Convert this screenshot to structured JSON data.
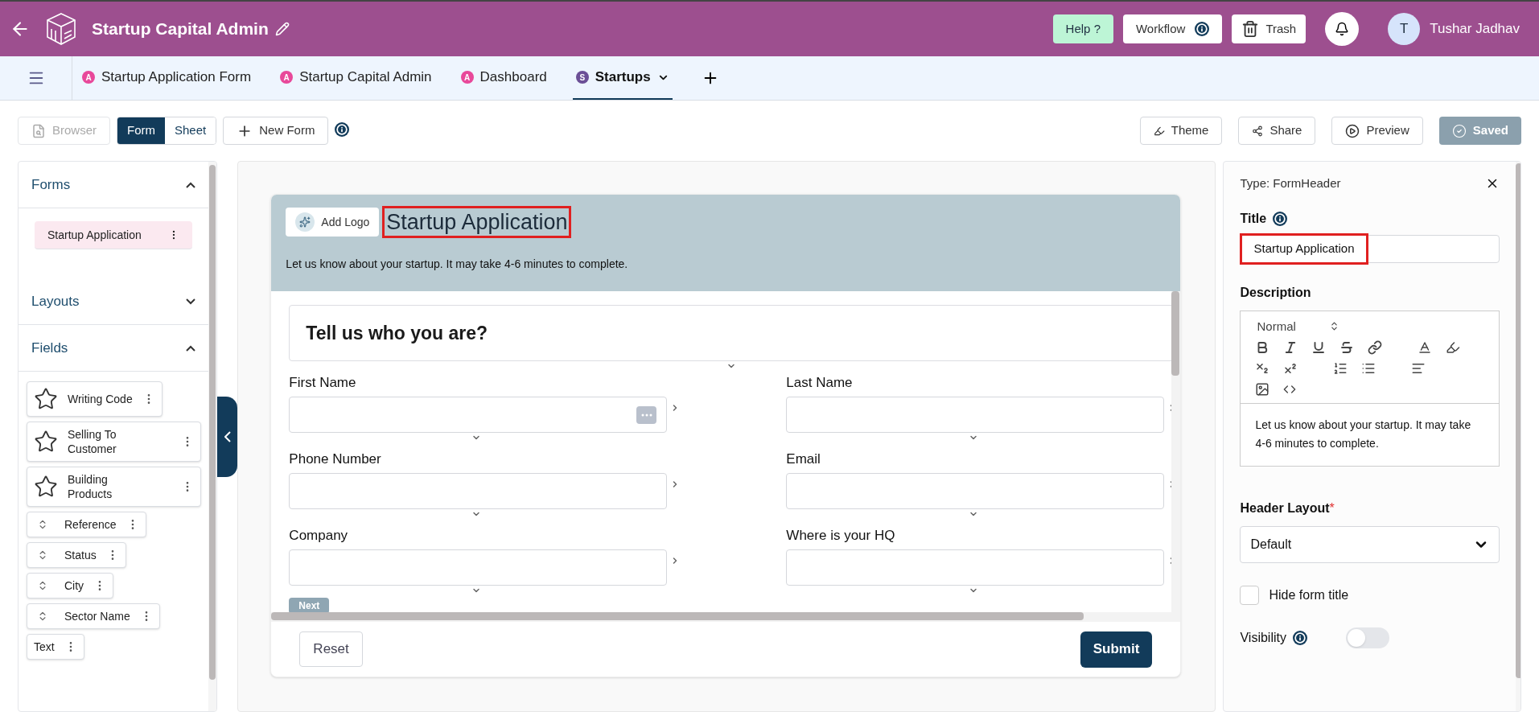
{
  "app_bar": {
    "title": "Startup Capital Admin",
    "help": "Help ?",
    "workflow": "Workflow",
    "trash": "Trash",
    "user": {
      "initial": "T",
      "name": "Tushar Jadhav"
    }
  },
  "tabs": [
    {
      "label": "Startup Application Form",
      "badge": "A",
      "color": "#e8489a",
      "selected": false
    },
    {
      "label": "Startup Capital Admin",
      "badge": "A",
      "color": "#e8489a",
      "selected": false
    },
    {
      "label": "Dashboard",
      "badge": "A",
      "color": "#e8489a",
      "selected": false
    },
    {
      "label": "Startups",
      "badge": "S",
      "color": "#6b4f96",
      "selected": true
    }
  ],
  "toolbar": {
    "browser": {
      "label": "Browser",
      "disabled": true
    },
    "views": [
      {
        "label": "Form",
        "selected": true
      },
      {
        "label": "Sheet",
        "selected": false
      }
    ],
    "new_form": "New Form",
    "theme": "Theme",
    "share": "Share",
    "preview": "Preview",
    "saved": {
      "label": "Saved",
      "disabled": true
    }
  },
  "sidebar": {
    "sections": [
      {
        "title": "Forms",
        "expanded": true
      },
      {
        "title": "Layouts",
        "expanded": false
      },
      {
        "title": "Fields",
        "expanded": true
      }
    ],
    "forms": [
      {
        "label": "Startup Application",
        "selected": true
      }
    ],
    "fields": [
      {
        "label": "Writing Code",
        "kind": "rating"
      },
      {
        "label": "Selling To Customer",
        "kind": "rating"
      },
      {
        "label": "Building Products",
        "kind": "rating"
      },
      {
        "label": "Reference",
        "kind": "lookup"
      },
      {
        "label": "Status",
        "kind": "lookup"
      },
      {
        "label": "City",
        "kind": "lookup"
      },
      {
        "label": "Sector Name",
        "kind": "lookup"
      },
      {
        "label": "Text",
        "kind": "text"
      }
    ]
  },
  "form": {
    "add_logo": "Add Logo",
    "title": "Startup Application",
    "title_highlighted": true,
    "description": "Let us know about your startup. It may take 4-6 minutes to complete.",
    "section": "Tell us who you are?",
    "rows": [
      [
        {
          "label": "First Name",
          "autofill_icon": true
        },
        {
          "label": "Last Name",
          "autofill_icon": false
        }
      ],
      [
        {
          "label": "Phone Number",
          "autofill_icon": false
        },
        {
          "label": "Email",
          "autofill_icon": false
        }
      ],
      [
        {
          "label": "Company",
          "autofill_icon": false
        },
        {
          "label": "Where is your HQ",
          "autofill_icon": false
        }
      ]
    ],
    "next": "Next",
    "reset": "Reset",
    "submit": "Submit"
  },
  "properties": {
    "type": "Type: FormHeader",
    "title_label": "Title",
    "title_value": "Startup Application",
    "title_highlighted": true,
    "description_label": "Description",
    "text_style": "Normal",
    "description": "Let us know about your startup. It may take 4-6 minutes to complete.",
    "header_layout_label": "Header Layout",
    "header_layout_required_mark": "*",
    "header_layout": "Default",
    "hide_title": {
      "label": "Hide form title",
      "checked": false
    },
    "visibility": {
      "label": "Visibility",
      "on": false
    }
  }
}
